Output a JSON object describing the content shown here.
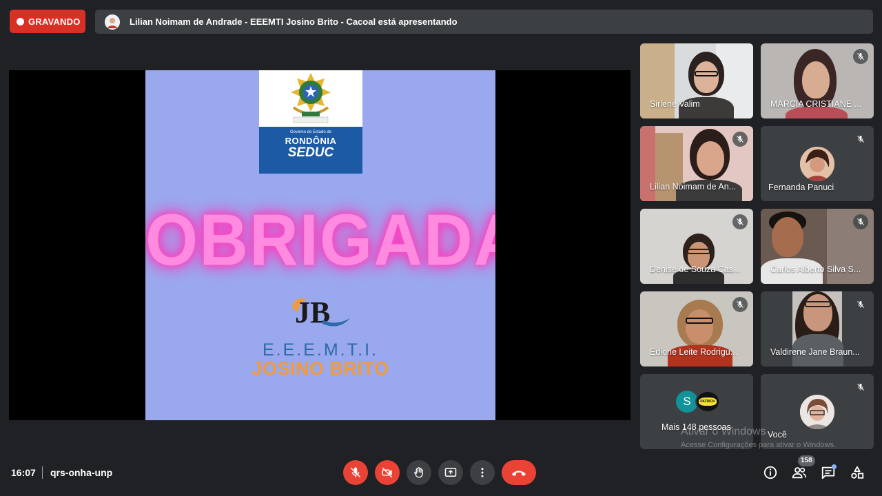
{
  "top": {
    "recording_label": "GRAVANDO",
    "presenting_text": "Lilian Noimam de Andrade - EEEMTI Josino Brito - Cacoal está apresentando"
  },
  "slide": {
    "seduc_small": "Governo do Estado de",
    "seduc_state": "RONDÔNIA",
    "seduc_org": "SEDUC",
    "headline": "OBRIGADA!",
    "school_line1": "E.E.E.M.T.I.",
    "school_line2": "JOSINO BRITO",
    "jb_letters": "JB"
  },
  "participants": [
    {
      "name": "Sirlene Valim"
    },
    {
      "name": "MARCIA CRISTIANE ..."
    },
    {
      "name": "Lilian Noimam de An..."
    },
    {
      "name": "Fernanda Panuci"
    },
    {
      "name": "Denise de Souza Cas..."
    },
    {
      "name": "Carlos Alberto Silva S..."
    },
    {
      "name": "Edione Leite Rodrigu..."
    },
    {
      "name": "Valdirene Jane Braun..."
    },
    {
      "name": "Mais 148 pessoas",
      "initial": "S",
      "second_avatar": "PATRICK"
    },
    {
      "name": "Você"
    }
  ],
  "bottom": {
    "time": "16:07",
    "meeting_code": "qrs-onha-unp",
    "participant_count": "158"
  },
  "watermark": {
    "line1": "Ativar o Windows",
    "line2": "Acesse Configurações para ativar o Windows."
  },
  "colors": {
    "background": "#202124",
    "recording": "#d93025",
    "slide_bg": "#9aa9ee",
    "headline_glow": "#ff8be0",
    "end_call": "#ea4335"
  }
}
